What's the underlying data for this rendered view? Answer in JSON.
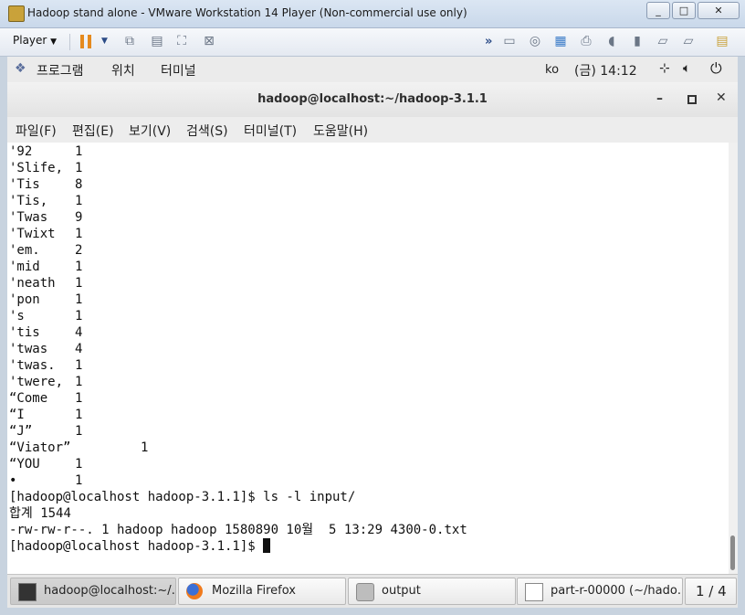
{
  "vmware": {
    "title": "Hadoop stand alone - VMware Workstation 14 Player (Non-commercial use only)",
    "player_menu": "Player"
  },
  "panel": {
    "applications": "프로그램",
    "places": "위치",
    "terminal": "터미널",
    "input_method": "ko",
    "clock": "(금) 14:12"
  },
  "terminal": {
    "title": "hadoop@localhost:~/hadoop-3.1.1",
    "menu": [
      "파일(F)",
      "편집(E)",
      "보기(V)",
      "검색(S)",
      "터미널(T)",
      "도움말(H)"
    ],
    "word_rows": [
      {
        "word": "'92",
        "count": "1"
      },
      {
        "word": "'Slife,",
        "count": "1"
      },
      {
        "word": "'Tis",
        "count": "8"
      },
      {
        "word": "'Tis,",
        "count": "1"
      },
      {
        "word": "'Twas",
        "count": "9"
      },
      {
        "word": "'Twixt",
        "count": "1"
      },
      {
        "word": "'em.",
        "count": "2"
      },
      {
        "word": "'mid",
        "count": "1"
      },
      {
        "word": "'neath",
        "count": "1"
      },
      {
        "word": "'pon",
        "count": "1"
      },
      {
        "word": "'s",
        "count": "1"
      },
      {
        "word": "'tis",
        "count": "4"
      },
      {
        "word": "'twas",
        "count": "4"
      },
      {
        "word": "'twas.",
        "count": "1"
      },
      {
        "word": "'twere,",
        "count": "1"
      },
      {
        "word": "“Come",
        "count": "1"
      },
      {
        "word": "“I",
        "count": "1"
      },
      {
        "word": "“J”",
        "count": "1"
      },
      {
        "word": "“Viator”",
        "count": "1"
      },
      {
        "word": "“YOU",
        "count": "1"
      },
      {
        "word": "•",
        "count": "1"
      }
    ],
    "cmd_line": "[hadoop@localhost hadoop-3.1.1]$ ls -l input/",
    "total_line": "합계 1544",
    "file_line": "-rw-rw-r--. 1 hadoop hadoop 1580890 10월  5 13:29 4300-0.txt",
    "prompt": "[hadoop@localhost hadoop-3.1.1]$ "
  },
  "taskbar": {
    "items": [
      "hadoop@localhost:~/…",
      "Mozilla Firefox",
      "output",
      "part-r-00000 (~/hado…"
    ],
    "workspace": "1 / 4"
  }
}
